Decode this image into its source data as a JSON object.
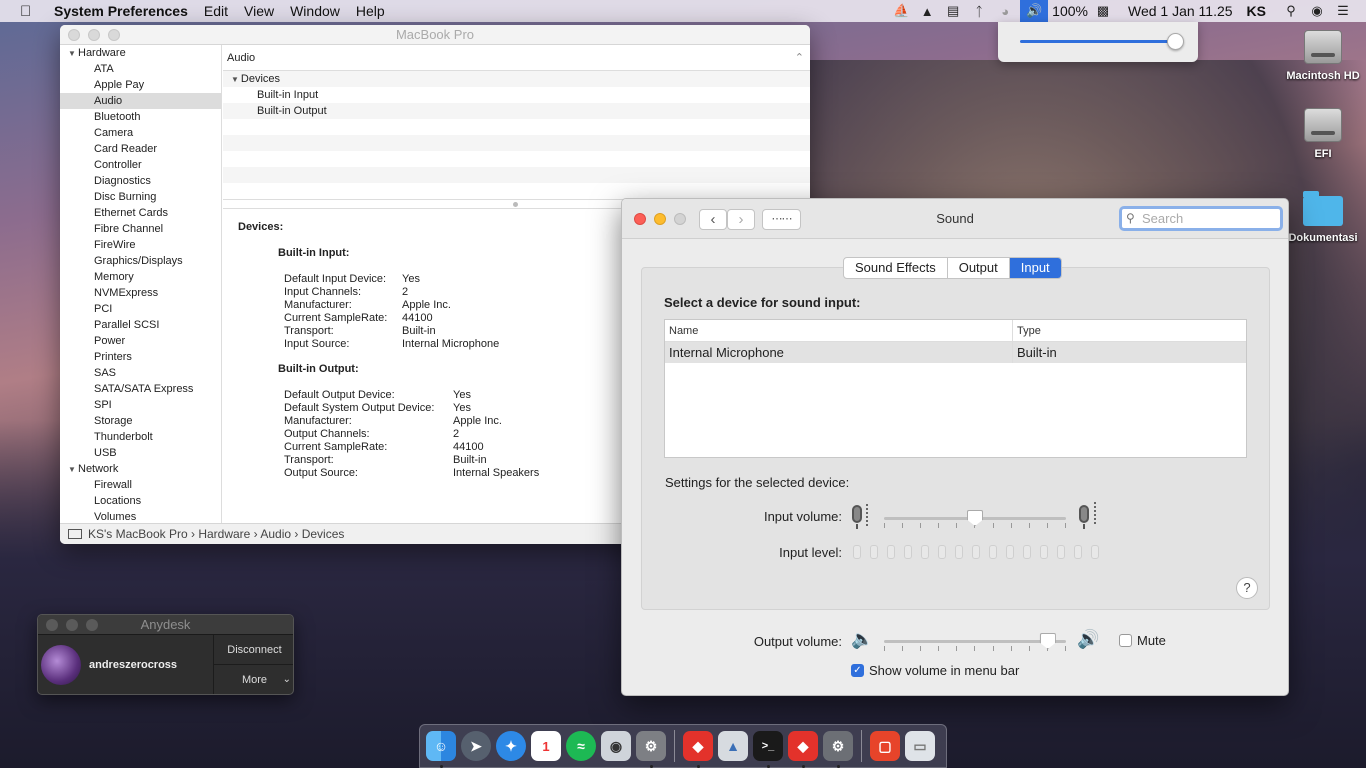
{
  "menubar": {
    "app_name": "System Preferences",
    "menus": [
      "Edit",
      "View",
      "Window",
      "Help"
    ],
    "battery": "100%",
    "datetime": "Wed 1 Jan  11.25",
    "user": "KS"
  },
  "desktop": {
    "icons": [
      "Macintosh HD",
      "EFI",
      "Dokumentasi"
    ]
  },
  "sysinfo": {
    "title": "MacBook Pro",
    "sidebar": {
      "group_hardware": "Hardware",
      "hardware_items": [
        "ATA",
        "Apple Pay",
        "Audio",
        "Bluetooth",
        "Camera",
        "Card Reader",
        "Controller",
        "Diagnostics",
        "Disc Burning",
        "Ethernet Cards",
        "Fibre Channel",
        "FireWire",
        "Graphics/Displays",
        "Memory",
        "NVMExpress",
        "PCI",
        "Parallel SCSI",
        "Power",
        "Printers",
        "SAS",
        "SATA/SATA Express",
        "SPI",
        "Storage",
        "Thunderbolt",
        "USB"
      ],
      "group_network": "Network",
      "network_items": [
        "Firewall",
        "Locations",
        "Volumes"
      ],
      "selected": "Audio"
    },
    "header": "Audio",
    "list": {
      "group": "Devices",
      "items": [
        "Built-in Input",
        "Built-in Output"
      ]
    },
    "detail": {
      "title": "Devices:",
      "input_title": "Built-in Input:",
      "input_rows": [
        {
          "k": "Default Input Device:",
          "v": "Yes"
        },
        {
          "k": "Input Channels:",
          "v": "2"
        },
        {
          "k": "Manufacturer:",
          "v": "Apple Inc."
        },
        {
          "k": "Current SampleRate:",
          "v": "44100"
        },
        {
          "k": "Transport:",
          "v": "Built-in"
        },
        {
          "k": "Input Source:",
          "v": "Internal Microphone"
        }
      ],
      "output_title": "Built-in Output:",
      "output_rows": [
        {
          "k": "Default Output Device:",
          "v": "Yes"
        },
        {
          "k": "Default System Output Device:",
          "v": "Yes"
        },
        {
          "k": "Manufacturer:",
          "v": "Apple Inc."
        },
        {
          "k": "Output Channels:",
          "v": "2"
        },
        {
          "k": "Current SampleRate:",
          "v": "44100"
        },
        {
          "k": "Transport:",
          "v": "Built-in"
        },
        {
          "k": "Output Source:",
          "v": "Internal Speakers"
        }
      ]
    },
    "breadcrumb": "KS's MacBook Pro › Hardware › Audio › Devices"
  },
  "anydesk": {
    "title": "Anydesk",
    "user": "andreszerocross",
    "disconnect": "Disconnect",
    "more": "More"
  },
  "sound": {
    "title": "Sound",
    "search_placeholder": "Search",
    "tabs": [
      "Sound Effects",
      "Output",
      "Input"
    ],
    "active_tab": "Input",
    "select_title": "Select a device for sound input:",
    "col_name": "Name",
    "col_type": "Type",
    "devices": [
      {
        "name": "Internal Microphone",
        "type": "Built-in"
      }
    ],
    "settings_title": "Settings for the selected device:",
    "input_volume_label": "Input volume:",
    "input_volume_level": 0.5,
    "input_level_label": "Input level:",
    "input_level_segments": 15,
    "help": "?",
    "output_volume_label": "Output volume:",
    "output_volume_level": 0.9,
    "mute_label": "Mute",
    "mute_checked": false,
    "show_volume_label": "Show volume in menu bar",
    "show_volume_checked": true
  },
  "menubar_volume_level": 0.95,
  "colors": {
    "accent": "#2f6fdc",
    "close": "#fc5f57",
    "minimize": "#fdbc2e"
  }
}
